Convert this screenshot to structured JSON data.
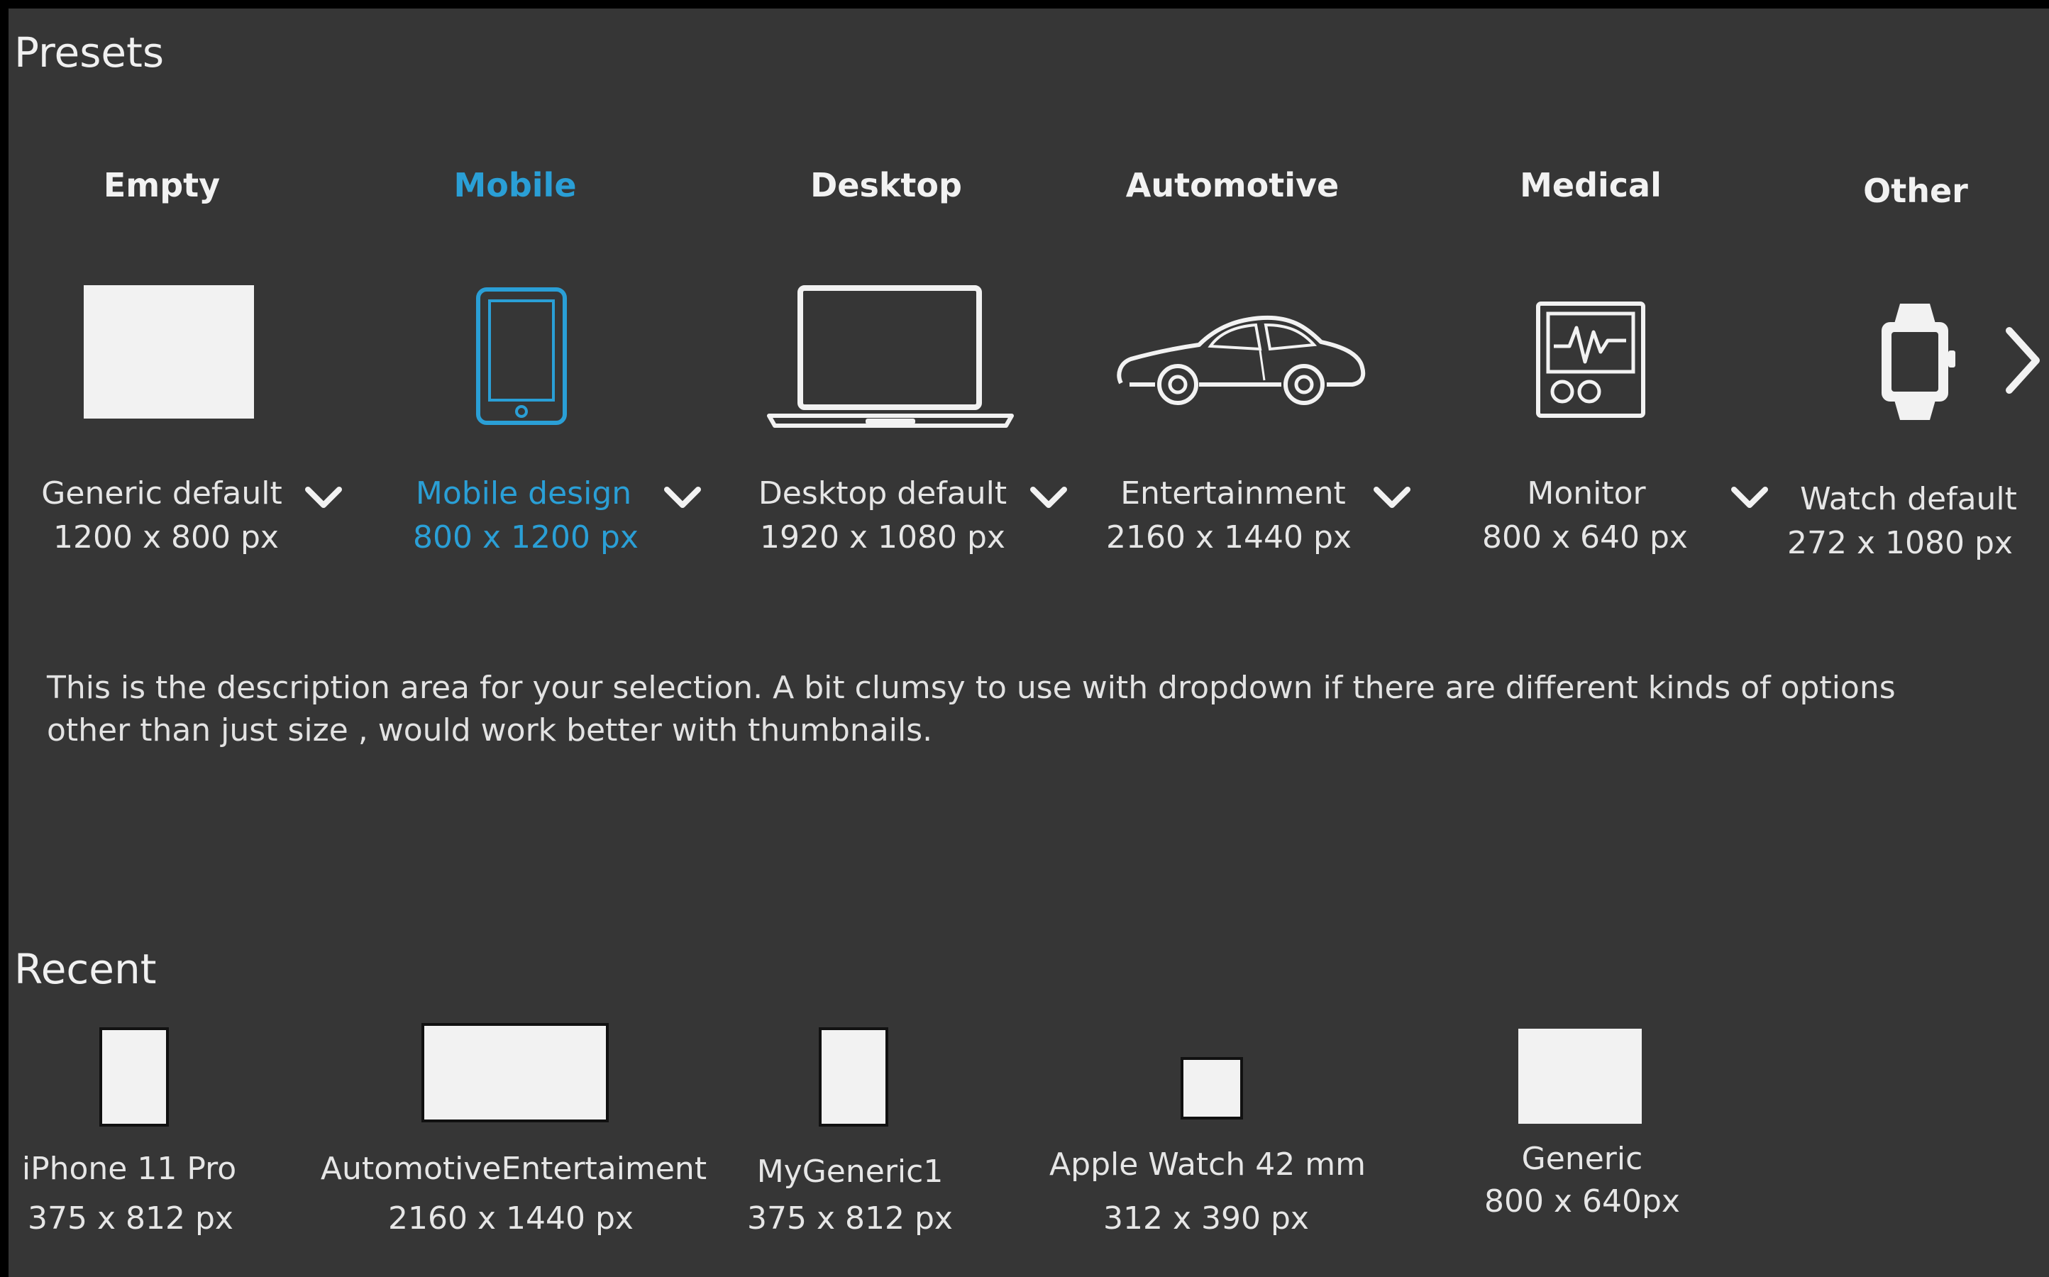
{
  "presets": {
    "title": "Presets",
    "categories": [
      {
        "title": "Empty",
        "preset": "Generic default",
        "size": "1200 x 800 px",
        "icon": "blank-canvas-icon"
      },
      {
        "title": "Mobile",
        "preset": "Mobile design",
        "size": "800 x 1200 px",
        "icon": "tablet-icon",
        "selected": true
      },
      {
        "title": "Desktop",
        "preset": "Desktop  default",
        "size": "1920 x 1080 px",
        "icon": "laptop-icon"
      },
      {
        "title": "Automotive",
        "preset": "Entertainment",
        "size": "2160 x 1440 px",
        "icon": "car-icon"
      },
      {
        "title": "Medical",
        "preset": "Monitor",
        "size": "800 x 640 px",
        "icon": "medical-monitor-icon"
      },
      {
        "title": "Other",
        "preset": "Watch default",
        "size": "272 x 1080 px",
        "icon": "smartwatch-icon"
      }
    ],
    "accent_color": "#2a9fd6"
  },
  "description": "This is the description area  for your selection. A bit clumsy to use with dropdown if there  are different kinds of options other than just size , would work  better with thumbnails.",
  "recent": {
    "title": "Recent",
    "items": [
      {
        "name": "iPhone 11 Pro",
        "size": "375 x 812 px"
      },
      {
        "name": "AutomotiveEntertaiment",
        "size": "2160 x 1440 px"
      },
      {
        "name": "MyGeneric1",
        "size": "375 x 812 px"
      },
      {
        "name": "Apple Watch 42 mm",
        "size": "312 x 390 px"
      },
      {
        "name": "Generic",
        "size": "800 x 640px"
      }
    ]
  }
}
